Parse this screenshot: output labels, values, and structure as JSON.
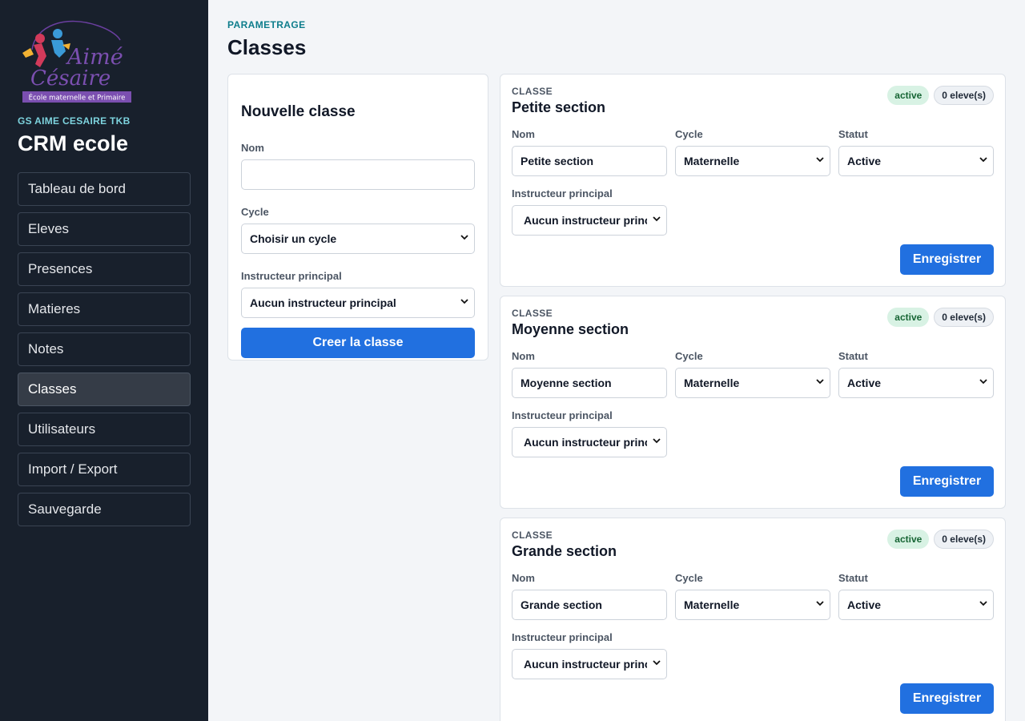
{
  "sidebar": {
    "logo": {
      "name_line1": "Aimé",
      "name_line2": "Césaire",
      "tagline": "École maternelle et Primaire"
    },
    "org_label": "GS AIME CESAIRE TKB",
    "app_title": "CRM ecole",
    "items": [
      {
        "label": "Tableau de bord"
      },
      {
        "label": "Eleves"
      },
      {
        "label": "Presences"
      },
      {
        "label": "Matieres"
      },
      {
        "label": "Notes"
      },
      {
        "label": "Classes",
        "active": true
      },
      {
        "label": "Utilisateurs"
      },
      {
        "label": "Import / Export"
      },
      {
        "label": "Sauvegarde"
      }
    ]
  },
  "header": {
    "eyebrow": "PARAMETRAGE",
    "title": "Classes"
  },
  "new_class": {
    "title": "Nouvelle classe",
    "name_label": "Nom",
    "name_value": "",
    "cycle_label": "Cycle",
    "cycle_value": "Choisir un cycle",
    "instructor_label": "Instructeur principal",
    "instructor_value": "Aucun instructeur principal",
    "submit_label": "Creer la classe"
  },
  "classes": [
    {
      "kicker": "CLASSE",
      "name": "Petite section",
      "status_badge": "active",
      "count_badge": "0 eleve(s)",
      "name_label": "Nom",
      "name_value": "Petite section",
      "cycle_label": "Cycle",
      "cycle_value": "Maternelle",
      "status_label": "Statut",
      "status_value": "Active",
      "instructor_label": "Instructeur principal",
      "instructor_value": "Aucun instructeur principal",
      "save_label": "Enregistrer"
    },
    {
      "kicker": "CLASSE",
      "name": "Moyenne section",
      "status_badge": "active",
      "count_badge": "0 eleve(s)",
      "name_label": "Nom",
      "name_value": "Moyenne section",
      "cycle_label": "Cycle",
      "cycle_value": "Maternelle",
      "status_label": "Statut",
      "status_value": "Active",
      "instructor_label": "Instructeur principal",
      "instructor_value": "Aucun instructeur principal",
      "save_label": "Enregistrer"
    },
    {
      "kicker": "CLASSE",
      "name": "Grande section",
      "status_badge": "active",
      "count_badge": "0 eleve(s)",
      "name_label": "Nom",
      "name_value": "Grande section",
      "cycle_label": "Cycle",
      "cycle_value": "Maternelle",
      "status_label": "Statut",
      "status_value": "Active",
      "instructor_label": "Instructeur principal",
      "instructor_value": "Aucun instructeur principal",
      "save_label": "Enregistrer"
    }
  ],
  "colors": {
    "sidebar_bg": "#18202c",
    "accent": "#2170e0",
    "eyebrow": "#0e7d8c",
    "active_badge_bg": "#d8f2e4",
    "logo_purple": "#7b4fb0"
  }
}
